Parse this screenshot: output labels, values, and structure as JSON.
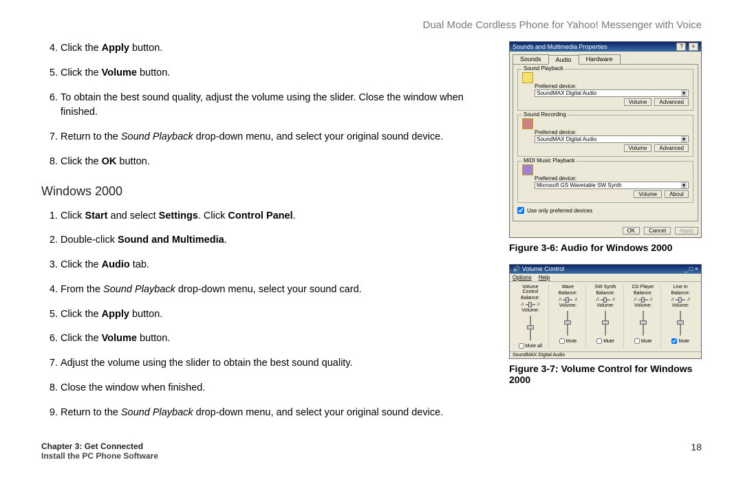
{
  "header": {
    "product": "Dual Mode Cordless Phone for Yahoo! Messenger with Voice"
  },
  "steps_a": {
    "start": 4,
    "items": [
      {
        "pre": "Click the ",
        "bold": "Apply",
        "post": " button."
      },
      {
        "pre": "Click the ",
        "bold": "Volume",
        "post": " button."
      },
      {
        "plain": "To obtain the best sound quality, adjust the volume using the slider. Close the window when finished."
      },
      {
        "pre": "Return to the ",
        "italic": "Sound Playback",
        "post": " drop-down menu, and select your original sound device."
      },
      {
        "pre": "Click the ",
        "bold": "OK",
        "post": " button."
      }
    ]
  },
  "heading_windows": "Windows 2000",
  "steps_b": {
    "start": 1,
    "items": [
      {
        "parts": [
          {
            "t": "Click ",
            "c": ""
          },
          {
            "t": "Start",
            "c": "bold"
          },
          {
            "t": " and select ",
            "c": ""
          },
          {
            "t": "Settings",
            "c": "bold"
          },
          {
            "t": ". Click ",
            "c": ""
          },
          {
            "t": "Control Panel",
            "c": "bold"
          },
          {
            "t": ".",
            "c": ""
          }
        ]
      },
      {
        "parts": [
          {
            "t": "Double-click ",
            "c": ""
          },
          {
            "t": "Sound and Multimedia",
            "c": "bold"
          },
          {
            "t": ".",
            "c": ""
          }
        ]
      },
      {
        "parts": [
          {
            "t": "Click the ",
            "c": ""
          },
          {
            "t": "Audio",
            "c": "bold"
          },
          {
            "t": " tab.",
            "c": ""
          }
        ]
      },
      {
        "parts": [
          {
            "t": "From the ",
            "c": ""
          },
          {
            "t": "Sound Playback",
            "c": "italic"
          },
          {
            "t": " drop-down menu, select your sound card.",
            "c": ""
          }
        ]
      },
      {
        "parts": [
          {
            "t": "Click the ",
            "c": ""
          },
          {
            "t": "Apply",
            "c": "bold"
          },
          {
            "t": " button.",
            "c": ""
          }
        ]
      },
      {
        "parts": [
          {
            "t": "Click the ",
            "c": ""
          },
          {
            "t": "Volume",
            "c": "bold"
          },
          {
            "t": " button.",
            "c": ""
          }
        ]
      },
      {
        "parts": [
          {
            "t": "Adjust the volume using the slider to obtain the best sound quality.",
            "c": ""
          }
        ]
      },
      {
        "parts": [
          {
            "t": "Close the window when finished.",
            "c": ""
          }
        ]
      },
      {
        "parts": [
          {
            "t": "Return to the ",
            "c": ""
          },
          {
            "t": "Sound Playback",
            "c": "italic"
          },
          {
            "t": " drop-down menu, and select your original sound device.",
            "c": ""
          }
        ]
      }
    ]
  },
  "figure1": {
    "caption": "Figure 3-6: Audio for Windows 2000",
    "title": "Sounds and Multimedia Properties",
    "tabs": [
      "Sounds",
      "Audio",
      "Hardware"
    ],
    "groups": {
      "playback": {
        "title": "Sound Playback",
        "label": "Preferred device:",
        "value": "SoundMAX Digital Audio",
        "btn1": "Volume",
        "btn2": "Advanced"
      },
      "recording": {
        "title": "Sound Recording",
        "label": "Preferred device:",
        "value": "SoundMAX Digital Audio",
        "btn1": "Volume",
        "btn2": "Advanced"
      },
      "midi": {
        "title": "MIDI Music Playback",
        "label": "Preferred device:",
        "value": "Microsoft GS Wavetable SW Synth",
        "btn1": "Volume",
        "btn2": "About"
      }
    },
    "checkbox": "Use only preferred devices",
    "buttons": [
      "OK",
      "Cancel",
      "Apply"
    ]
  },
  "figure2": {
    "caption": "Figure 3-7: Volume Control for Windows 2000",
    "title": "Volume Control",
    "menu": [
      "Options",
      "Help"
    ],
    "channels": [
      {
        "name": "Volume Control",
        "bal": "Balance:",
        "vol": "Volume:",
        "mute": "Mute all"
      },
      {
        "name": "Wave",
        "bal": "Balance:",
        "vol": "Volume:",
        "mute": "Mute"
      },
      {
        "name": "SW Synth",
        "bal": "Balance:",
        "vol": "Volume:",
        "mute": "Mute"
      },
      {
        "name": "CD Player",
        "bal": "Balance:",
        "vol": "Volume:",
        "mute": "Mute"
      },
      {
        "name": "Line In",
        "bal": "Balance:",
        "vol": "Volume:",
        "mute": "Mute"
      }
    ],
    "status": "SoundMAX Digital Audio"
  },
  "footer": {
    "chapter": "Chapter 3: Get Connected",
    "section": "Install the PC Phone Software",
    "page": "18"
  }
}
